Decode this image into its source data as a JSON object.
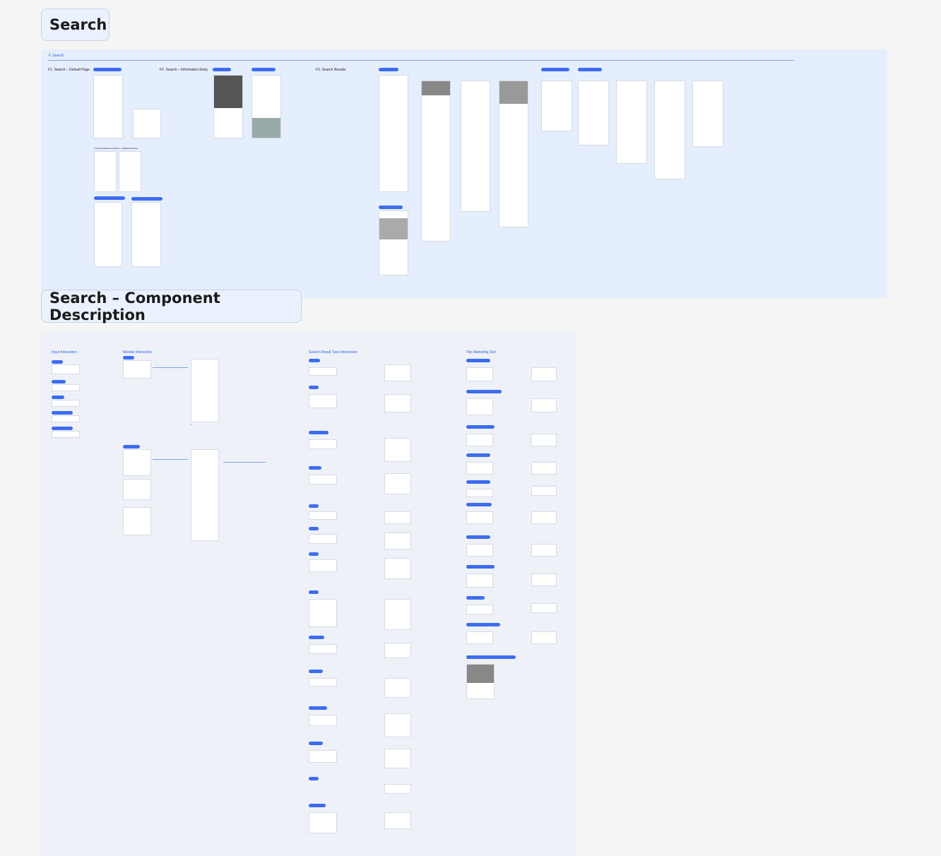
{
  "sections": {
    "search_label": "Search",
    "component_label": "Search – Component Description"
  },
  "board_a": {
    "header": "F. Search",
    "col_titles": [
      "F1. Search – Default Page",
      "F2. Search – Information Entry",
      "F3. Search Results"
    ],
    "sub_title": "Trending Searches Section – Fallback Solution"
  },
  "board_b": {
    "col_titles": [
      "Input Interaction",
      "Module Interaction",
      "Search Result Type Interaction",
      "Top Marketing Slot"
    ]
  },
  "colors": {
    "accent": "#3d6cf0",
    "board_a_bg": "#e5eefc",
    "board_b_bg": "#eef1f7",
    "label_bg": "#eaf1ff"
  }
}
